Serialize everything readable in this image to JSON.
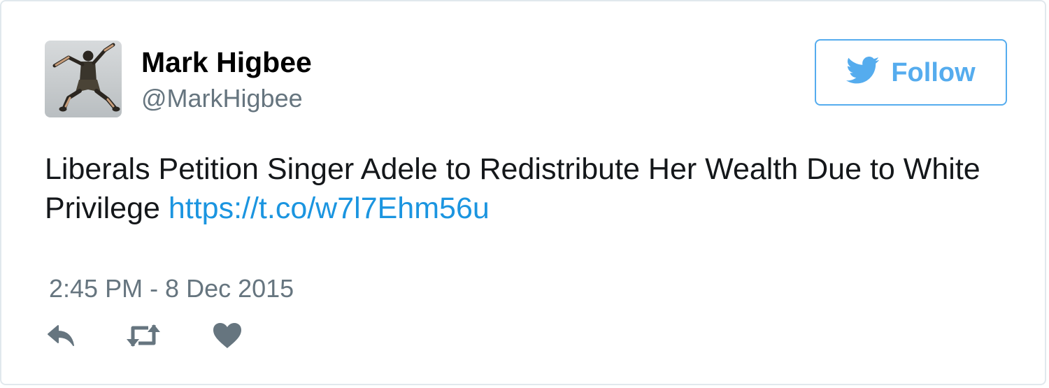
{
  "tweet": {
    "author": {
      "name": "Mark Higbee",
      "handle": "@MarkHigbee",
      "avatar_icon": "person-jumping-avatar"
    },
    "follow_button": {
      "label": "Follow",
      "icon": "twitter-bird-icon"
    },
    "text": "Liberals Petition Singer Adele to Redistribute Her Wealth Due to White Privilege",
    "link": "https://t.co/w7l7Ehm56u",
    "timestamp": "2:45 PM - 8 Dec 2015",
    "actions": [
      {
        "name": "reply",
        "icon": "reply-icon"
      },
      {
        "name": "retweet",
        "icon": "retweet-icon"
      },
      {
        "name": "like",
        "icon": "heart-icon"
      }
    ]
  },
  "colors": {
    "accent": "#55acee",
    "link": "#1b95e0",
    "secondary_text": "#66757f",
    "border": "#e1e8ed"
  }
}
